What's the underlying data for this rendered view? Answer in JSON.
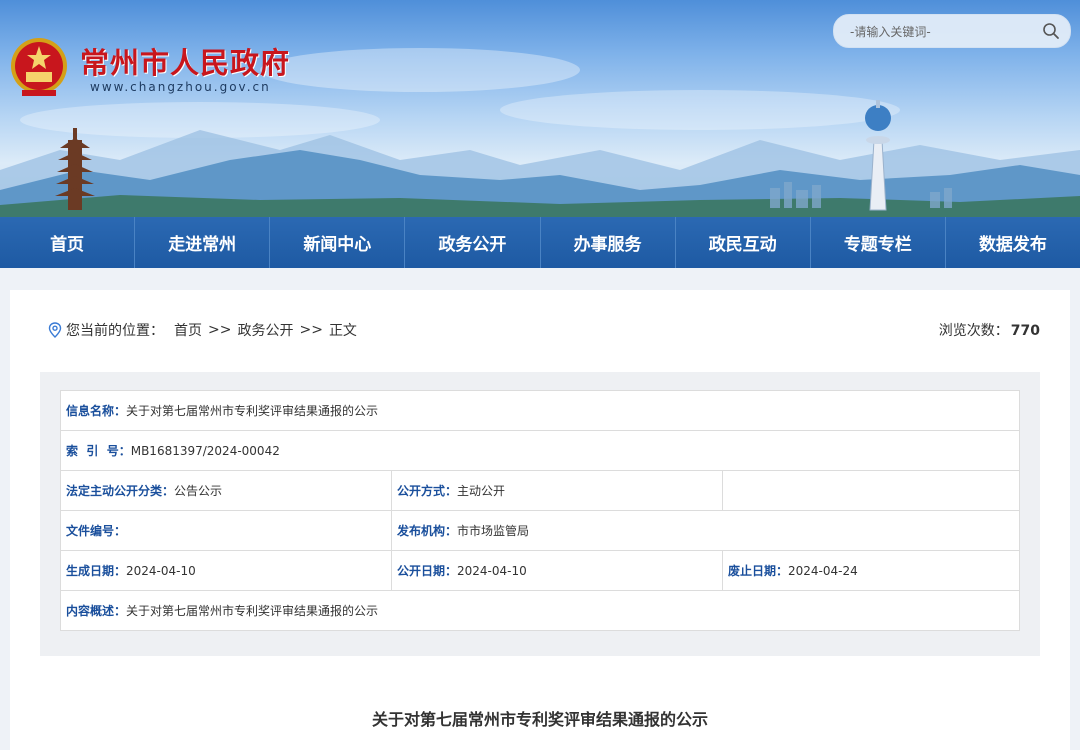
{
  "header": {
    "site_title": "常州市人民政府",
    "site_url": "www.changzhou.gov.cn",
    "search_placeholder": "-请输入关键词-"
  },
  "nav": {
    "items": [
      "首页",
      "走进常州",
      "新闻中心",
      "政务公开",
      "办事服务",
      "政民互动",
      "专题专栏",
      "数据发布"
    ]
  },
  "breadcrumb": {
    "prefix": "您当前的位置：",
    "items": [
      "首页",
      "政务公开",
      "正文"
    ],
    "separator": ">>"
  },
  "views": {
    "label": "浏览次数：",
    "count": "770"
  },
  "info": {
    "name_label": "信息名称：",
    "name_value": "关于对第七届常州市专利奖评审结果通报的公示",
    "index_label": "索  引  号：",
    "index_value": "MB1681397/2024-00042",
    "category_label": "法定主动公开分类：",
    "category_value": "公告公示",
    "method_label": "公开方式：",
    "method_value": "主动公开",
    "docno_label": "文件编号：",
    "docno_value": "",
    "org_label": "发布机构：",
    "org_value": "市市场监管局",
    "created_label": "生成日期：",
    "created_value": "2024-04-10",
    "published_label": "公开日期：",
    "published_value": "2024-04-10",
    "expire_label": "废止日期：",
    "expire_value": "2024-04-24",
    "summary_label": "内容概述：",
    "summary_value": "关于对第七届常州市专利奖评审结果通报的公示"
  },
  "article": {
    "title": "关于对第七届常州市专利奖评审结果通报的公示"
  },
  "colors": {
    "nav_bg": "#1e5aa3",
    "title_red": "#c8161d",
    "label_blue": "#1a4f9c"
  }
}
